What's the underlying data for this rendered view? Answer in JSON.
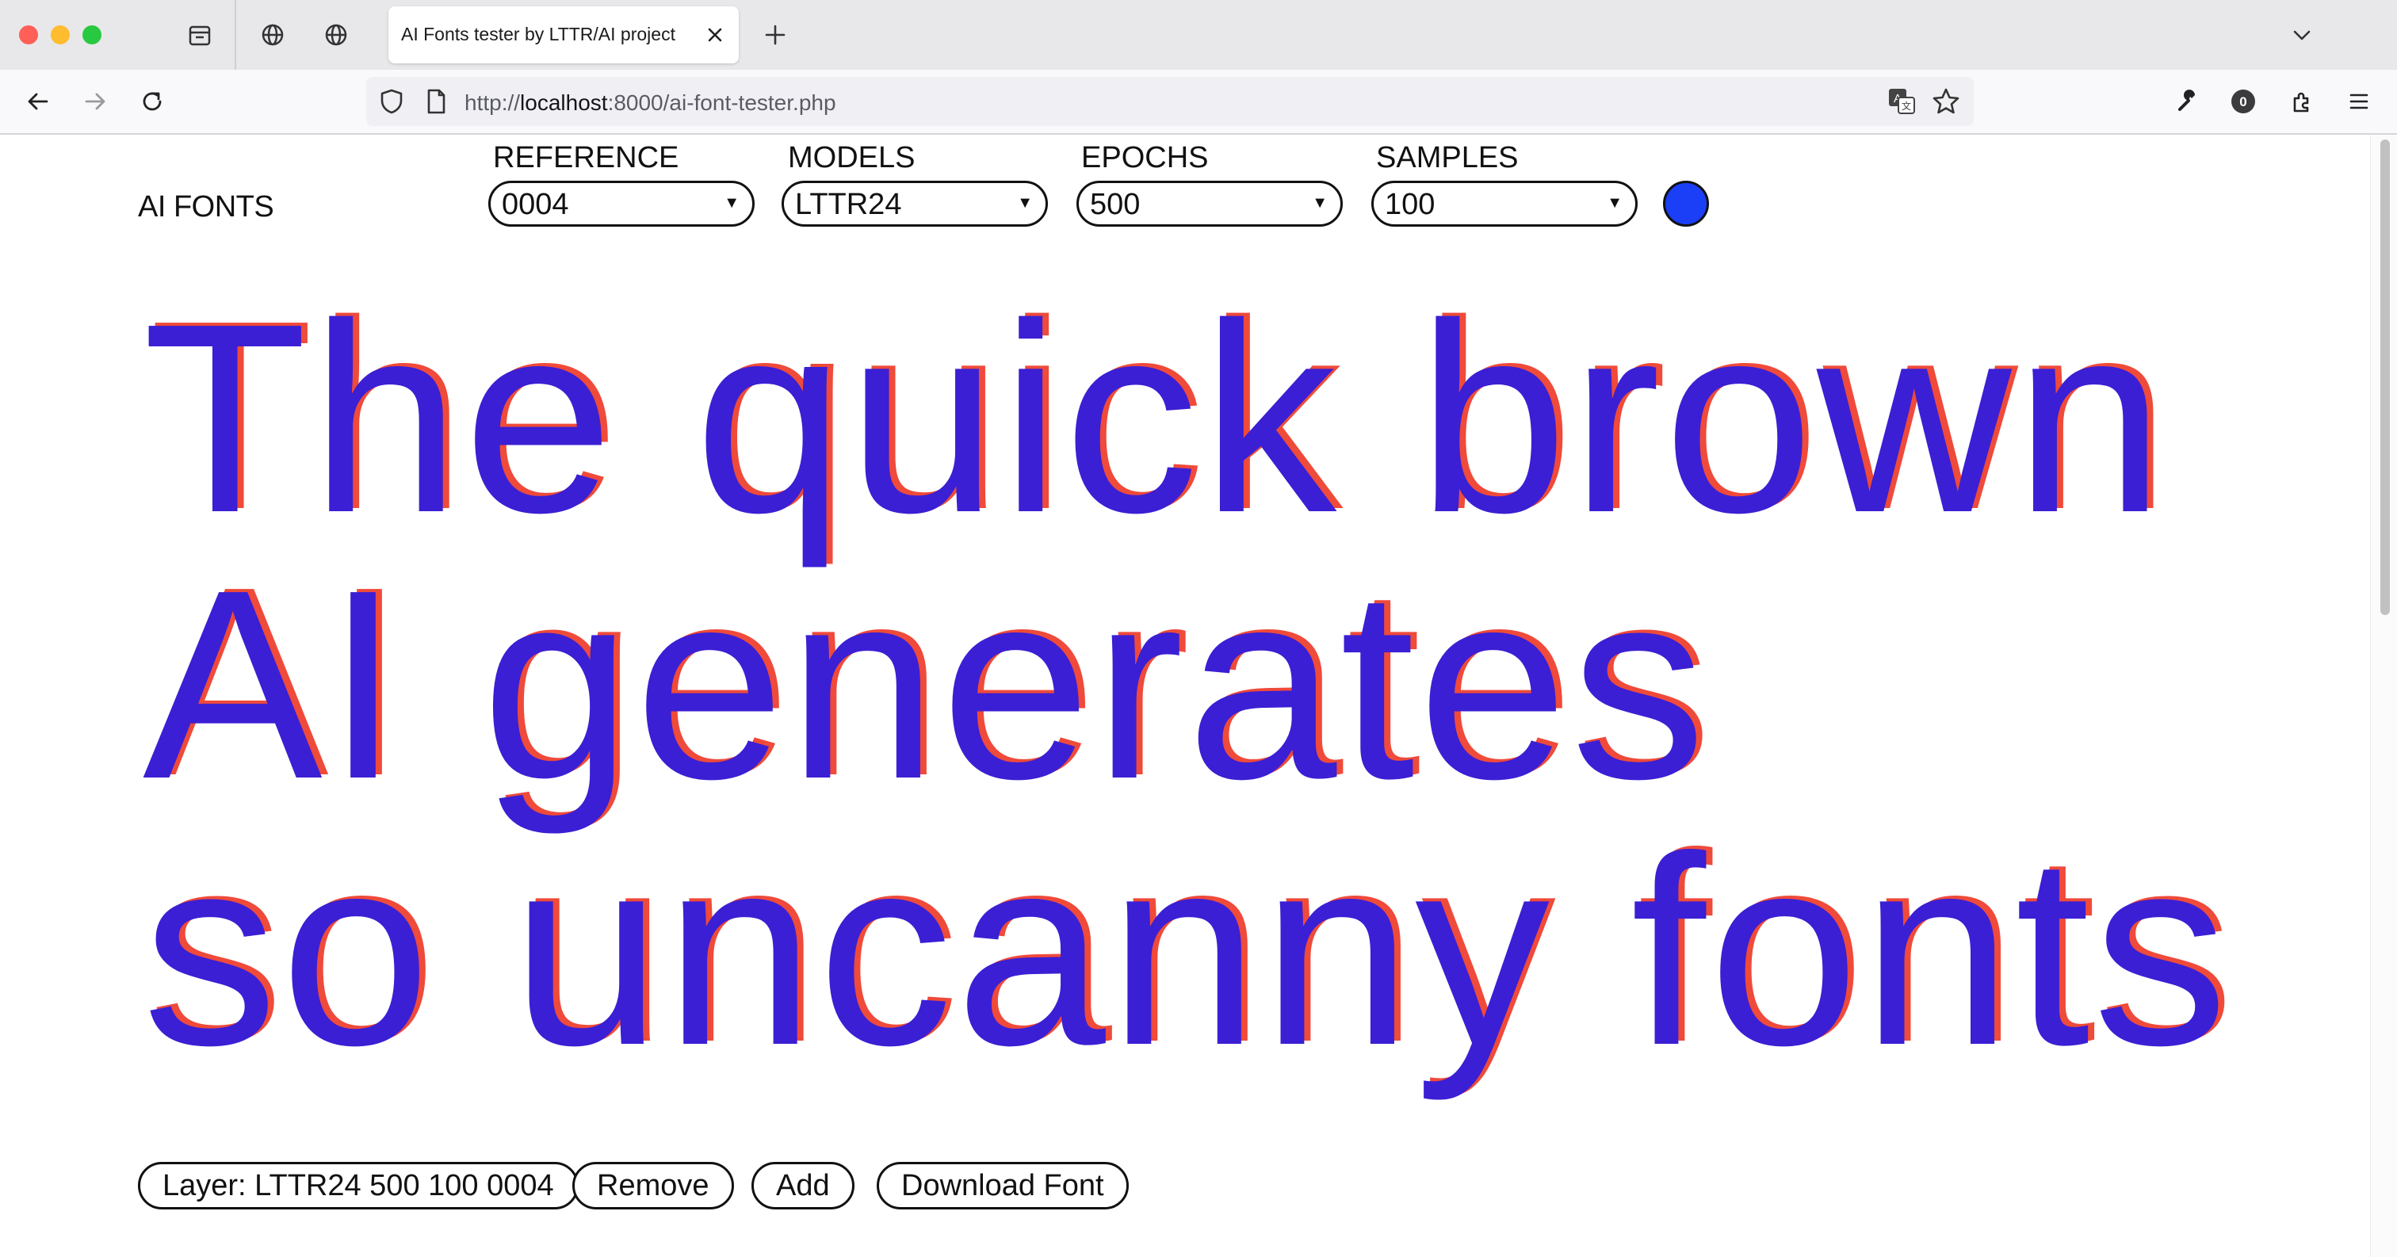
{
  "browser": {
    "tab_title": "AI Fonts tester by LTTR/AI project",
    "url_prefix": "http://",
    "url_host": "localhost",
    "url_rest": ":8000/ai-font-tester.php",
    "icons": [
      "tab-groups-icon",
      "globe-icon",
      "globe-icon",
      "close-icon",
      "plus-icon",
      "chevron-down-icon",
      "back-icon",
      "forward-icon",
      "reload-icon",
      "shield-icon",
      "page-icon",
      "translate-icon",
      "star-icon",
      "wrench-icon",
      "account-icon",
      "extensions-icon",
      "menu-icon"
    ],
    "account_badge": "0"
  },
  "app": {
    "brand": "AI FONTS",
    "controls": [
      {
        "label": "REFERENCE",
        "value": "0004"
      },
      {
        "label": "MODELS",
        "value": "LTTR24"
      },
      {
        "label": "EPOCHS",
        "value": "500"
      },
      {
        "label": "SAMPLES",
        "value": "100"
      }
    ],
    "color": "#1b3ff6",
    "sample_lines": [
      "The quick brown",
      "AI generates",
      "so uncanny fonts"
    ],
    "layer_label": "Layer: LTTR24 500 100 0004",
    "buttons": {
      "remove": "Remove",
      "add": "Add",
      "download": "Download Font"
    },
    "colors": {
      "glyph_main": "#3a1fd4",
      "glyph_ghost": "#ef4a3a"
    }
  }
}
